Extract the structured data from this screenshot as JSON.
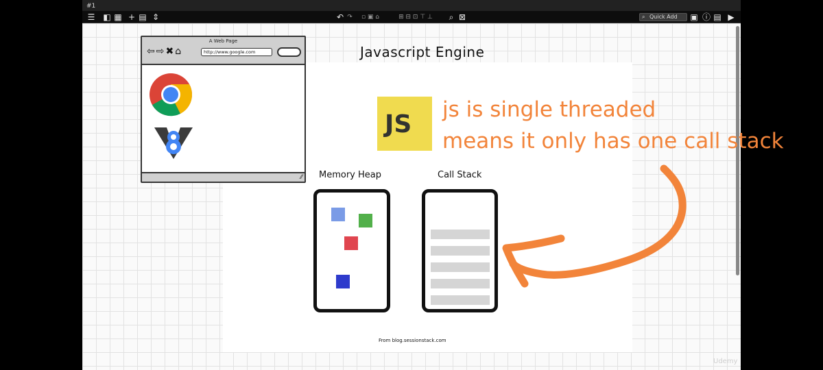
{
  "window": {
    "tab_number": "#1"
  },
  "toolbar": {
    "quick_add_label": "Quick Add",
    "left_icons": [
      "menu-icon",
      "panel-icon",
      "grid-icon",
      "plus-icon",
      "page-icon",
      "updown-icon"
    ],
    "center_icons": [
      "undo-icon",
      "redo-icon",
      "zoom-icon",
      "fullscreen-icon"
    ],
    "right_icons": [
      "layout-icon",
      "info-icon",
      "list-icon",
      "play-icon"
    ]
  },
  "slide": {
    "title": "Javascript Engine",
    "browser_mock": {
      "page_title": "A Web Page",
      "url": "http://www.google.com"
    },
    "js_logo_text": "JS",
    "memory_heap_label": "Memory Heap",
    "call_stack_label": "Call Stack",
    "source_credit": "From blog.sessionstack.com",
    "heap_object_colors": [
      "#7a9be6",
      "#52b04a",
      "#e0454f",
      "#2e3bcc"
    ],
    "call_stack_frame_color": "#d5d5d5"
  },
  "annotation": {
    "line1": "js is single threaded",
    "line2": "means it only has one call stack",
    "color": "#f2843a"
  },
  "watermark": "Udemy"
}
